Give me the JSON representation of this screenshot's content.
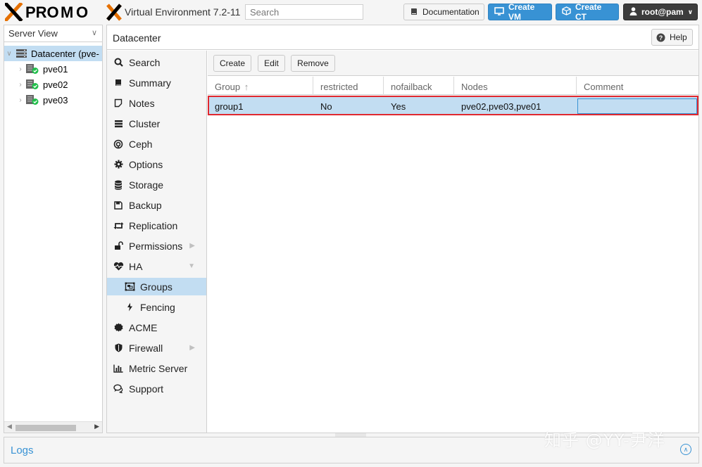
{
  "header": {
    "logo_text": "PROXMOX",
    "version": "Virtual Environment 7.2-11",
    "search_placeholder": "Search",
    "documentation": "Documentation",
    "create_vm": "Create VM",
    "create_ct": "Create CT",
    "user": "root@pam"
  },
  "tree": {
    "view": "Server View",
    "datacenter": "Datacenter (pve-",
    "nodes": [
      "pve01",
      "pve02",
      "pve03"
    ]
  },
  "main": {
    "title": "Datacenter",
    "help": "Help"
  },
  "nav": {
    "items": [
      "Search",
      "Summary",
      "Notes",
      "Cluster",
      "Ceph",
      "Options",
      "Storage",
      "Backup",
      "Replication",
      "Permissions",
      "HA",
      "Groups",
      "Fencing",
      "ACME",
      "Firewall",
      "Metric Server",
      "Support"
    ]
  },
  "toolbar": {
    "create": "Create",
    "edit": "Edit",
    "remove": "Remove"
  },
  "grid": {
    "columns": [
      "Group",
      "restricted",
      "nofailback",
      "Nodes",
      "Comment"
    ],
    "sort_indicator": "↑",
    "rows": [
      {
        "group": "group1",
        "restricted": "No",
        "nofailback": "Yes",
        "nodes": "pve02,pve03,pve01",
        "comment": ""
      }
    ]
  },
  "logs": {
    "title": "Logs"
  },
  "watermark": "知乎 @YY-尹洋",
  "colors": {
    "accent": "#3892d4",
    "selection": "#c2ddf2",
    "highlight_border": "#e0282f",
    "logo_orange": "#e57000"
  }
}
